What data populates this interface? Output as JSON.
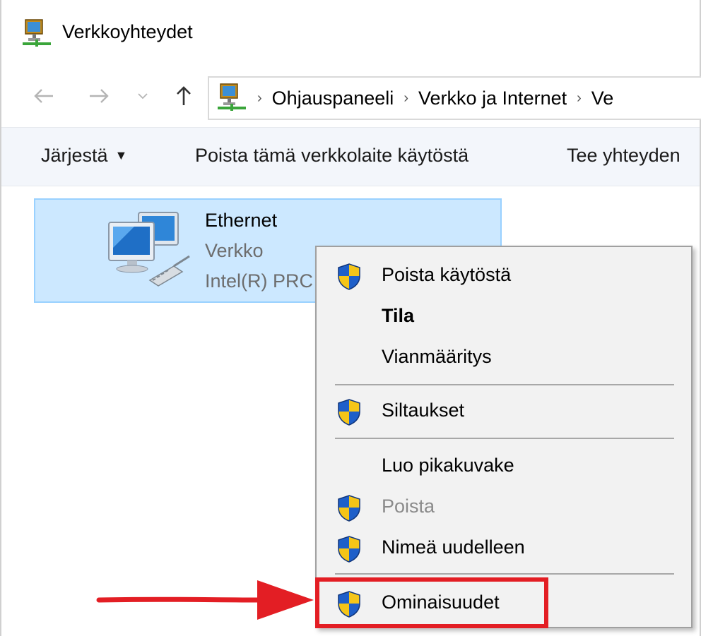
{
  "window": {
    "title": "Verkkoyhteydet"
  },
  "nav": {
    "back_icon": "back-arrow-icon",
    "forward_icon": "forward-arrow-icon",
    "recent_icon": "chevron-down-icon",
    "up_icon": "up-arrow-icon",
    "breadcrumbs": [
      "Ohjauspaneeli",
      "Verkko ja Internet",
      "Ve"
    ]
  },
  "commands": {
    "organize": "Järjestä",
    "disable_device": "Poista tämä verkkolaite käytöstä",
    "diagnose": "Tee yhteyden"
  },
  "connection": {
    "name": "Ethernet",
    "type": "Verkko",
    "adapter": "Intel(R) PRC"
  },
  "context_menu": {
    "items": [
      {
        "label": "Poista käytöstä",
        "shield": true,
        "bold": false,
        "disabled": false
      },
      {
        "label": "Tila",
        "shield": false,
        "bold": true,
        "disabled": false
      },
      {
        "label": "Vianmääritys",
        "shield": false,
        "bold": false,
        "disabled": false
      },
      {
        "label": "Siltaukset",
        "shield": true,
        "bold": false,
        "disabled": false
      },
      {
        "label": "Luo pikakuvake",
        "shield": false,
        "bold": false,
        "disabled": false
      },
      {
        "label": "Poista",
        "shield": true,
        "bold": false,
        "disabled": true
      },
      {
        "label": "Nimeä uudelleen",
        "shield": true,
        "bold": false,
        "disabled": false
      },
      {
        "label": "Ominaisuudet",
        "shield": true,
        "bold": false,
        "disabled": false
      }
    ]
  },
  "annotation": {
    "highlight_color": "#e31e24"
  }
}
